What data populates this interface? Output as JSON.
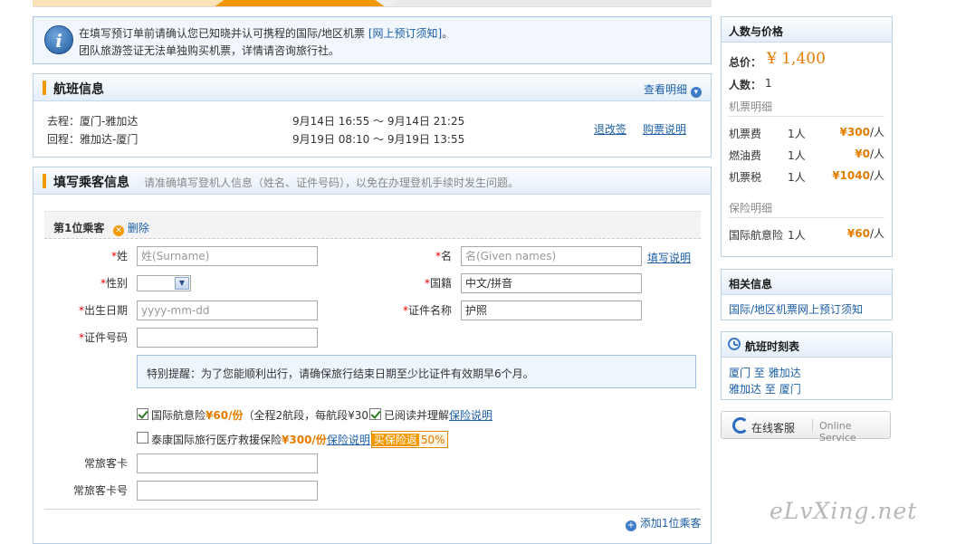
{
  "notice": {
    "line1": "在填写预订单前请确认您已知晓并认可携程的国际/地区机票",
    "link": "[网上预订须知]",
    "line1_end": "。",
    "line2": "团队旅游签证无法单独购买机票，详情请咨询旅行社。"
  },
  "flight": {
    "title": "航班信息",
    "detail_link": "查看明细",
    "rows": [
      {
        "label": "去程：厦门-雅加达",
        "time": "9月14日 16:55 ～ 9月14日 21:25"
      },
      {
        "label": "回程：雅加达-厦门",
        "time": "9月19日 08:10 ～ 9月19日 13:55"
      }
    ],
    "refund_link": "退改签",
    "purchase_link": "购票说明"
  },
  "passenger": {
    "title": "填写乘客信息",
    "subtitle": "请准确填写登机人信息（姓名、证件号码），以免在办理登机手续时发生问题。",
    "index_label": "第1位乘客",
    "delete_label": "删除",
    "surname_label": "姓",
    "surname_placeholder": "姓(Surname)",
    "given_label": "名",
    "given_placeholder": "名(Given names)",
    "fill_help": "填写说明",
    "gender_label": "性别",
    "nationality_label": "国籍",
    "nationality_value": "中文/拼音",
    "birth_label": "出生日期",
    "birth_placeholder": "yyyy-mm-dd",
    "id_type_label": "证件名称",
    "id_type_value": "护照",
    "id_no_label": "证件号码",
    "reminder": "特别提醒：为了您能顺利出行，请确保旅行结束日期至少比证件有效期早6个月。",
    "ins1_text": "国际航意险",
    "ins1_price": "¥60/份",
    "ins1_detail": "（全程2航段，每航段¥30）",
    "ins1_read": "已阅读并理解",
    "ins1_link": "保险说明",
    "ins2_text": "泰康国际旅行医疗救援保险",
    "ins2_price": "¥300/份",
    "ins2_link": "保险说明",
    "ins2_badge": "买保险返",
    "ins2_badge_pct": "50%",
    "ff_card_label": "常旅客卡",
    "ff_no_label": "常旅客卡号",
    "add_passenger": "添加1位乘客"
  },
  "price": {
    "title": "人数与价格",
    "total_label": "总价：",
    "total_value": "¥ 1,400",
    "count_label": "人数：",
    "count_value": "1",
    "ticket_section": "机票明细",
    "ticket_rows": [
      {
        "name": "机票费",
        "qty": "1人",
        "price": "¥300",
        "unit": "/人"
      },
      {
        "name": "燃油费",
        "qty": "1人",
        "price": "¥0",
        "unit": "/人"
      },
      {
        "name": "机票税",
        "qty": "1人",
        "price": "¥1040",
        "unit": "/人"
      }
    ],
    "insurance_section": "保险明细",
    "insurance_rows": [
      {
        "name": "国际航意险",
        "qty": "1人",
        "price": "¥60",
        "unit": "/人"
      }
    ]
  },
  "related": {
    "title": "相关信息",
    "link": "国际/地区机票网上预订须知"
  },
  "schedule": {
    "title": "航班时刻表",
    "r1_from": "厦门",
    "r1_to": "雅加达",
    "r2_from": "雅加达",
    "r2_to": "厦门",
    "to_word": "至"
  },
  "service": {
    "label": "在线客服",
    "english": "Online Service"
  },
  "watermark": "eLvXing.net",
  "colors": {
    "accent": "#f39800",
    "link": "#1d5fa7",
    "price": "#e57c00",
    "border": "#b9cfe4"
  }
}
